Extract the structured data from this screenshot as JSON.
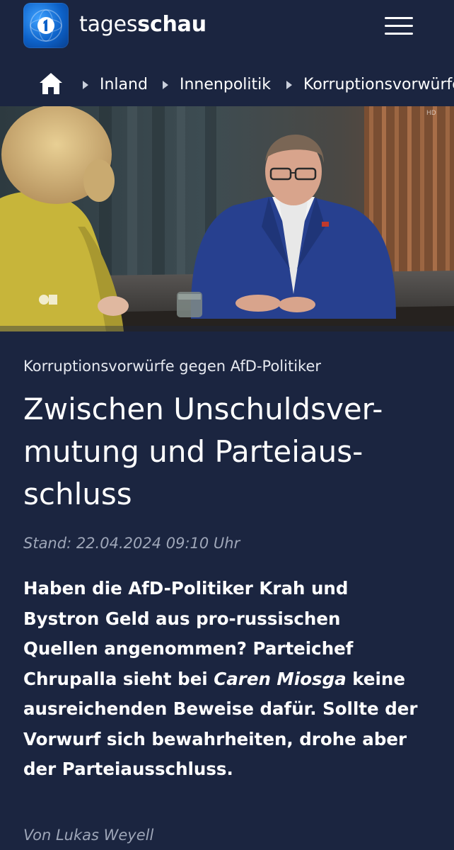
{
  "header": {
    "brand_light": "tages",
    "brand_bold": "schau",
    "logo_icon": "tagesschau-globe-logo",
    "menu_icon": "hamburger-menu-icon"
  },
  "breadcrumb": {
    "home_icon": "home-icon",
    "items": [
      "Inland",
      "Innenpolitik",
      "Korruptionsvorwürfe"
    ]
  },
  "hero": {
    "image": "TV talk show scene: presenter in yellow jacket facing a guest in a blue suit at a table"
  },
  "article": {
    "kicker": "Korruptionsvorwürfe gegen AfD-Politiker",
    "headline_lines": [
      "Zwischen Unschuldsver-",
      "mutung und Parteiaus-",
      "schluss"
    ],
    "stand": "Stand: 22.04.2024 09:10 Uhr",
    "teaser": {
      "line1": "Haben die AfD-Politiker Krah und",
      "line2": "Bystron Geld aus pro-russischen",
      "line3": "Quellen angenommen? Parteichef",
      "line4_pre": "Chrupalla sieht bei ",
      "line4_em": "Caren Miosga",
      "line4_post": " keine",
      "line5": "ausreichenden Beweise dafür. Sollte der",
      "line6": "Vorwurf sich bewahrheiten, drohe aber",
      "line7": "der Parteiausschluss."
    },
    "author": "Von Lukas Weyell"
  },
  "colors": {
    "background": "#1b2540",
    "text": "#ffffff",
    "muted": "#9ea6b8",
    "logo_blue": "#0d62c9"
  }
}
